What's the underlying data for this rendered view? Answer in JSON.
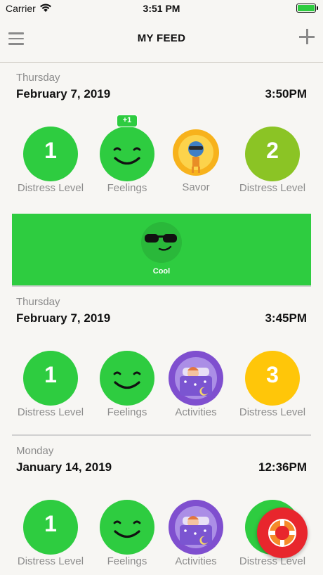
{
  "status_bar": {
    "carrier": "Carrier",
    "time": "3:51 PM"
  },
  "nav": {
    "title": "MY FEED"
  },
  "entries": [
    {
      "day": "Thursday",
      "date": "February 7, 2019",
      "time": "3:50PM",
      "items": [
        {
          "type": "distress",
          "value": "1",
          "label": "Distress Level",
          "color": "#2ecc40"
        },
        {
          "type": "feelings",
          "label": "Feelings",
          "badge": "+1",
          "color": "#2ecc40"
        },
        {
          "type": "savor",
          "label": "Savor"
        },
        {
          "type": "distress",
          "value": "2",
          "label": "Distress Level",
          "color": "#8bc425"
        }
      ],
      "expanded": {
        "caption": "Cool",
        "color": "#2ecc40"
      }
    },
    {
      "day": "Thursday",
      "date": "February 7, 2019",
      "time": "3:45PM",
      "items": [
        {
          "type": "distress",
          "value": "1",
          "label": "Distress Level",
          "color": "#2ecc40"
        },
        {
          "type": "feelings",
          "label": "Feelings",
          "color": "#2ecc40"
        },
        {
          "type": "activities",
          "label": "Activities"
        },
        {
          "type": "distress",
          "value": "3",
          "label": "Distress Level",
          "color": "#ffc609"
        }
      ]
    },
    {
      "day": "Monday",
      "date": "January 14, 2019",
      "time": "12:36PM",
      "items": [
        {
          "type": "distress",
          "value": "1",
          "label": "Distress Level",
          "color": "#2ecc40"
        },
        {
          "type": "feelings",
          "label": "Feelings",
          "color": "#2ecc40"
        },
        {
          "type": "activities",
          "label": "Activities"
        },
        {
          "type": "distress",
          "value": "",
          "label": "Distress Level",
          "color": "#2ecc40"
        }
      ]
    }
  ],
  "fab": {
    "icon": "lifebuoy-icon",
    "color": "#e8262d"
  }
}
